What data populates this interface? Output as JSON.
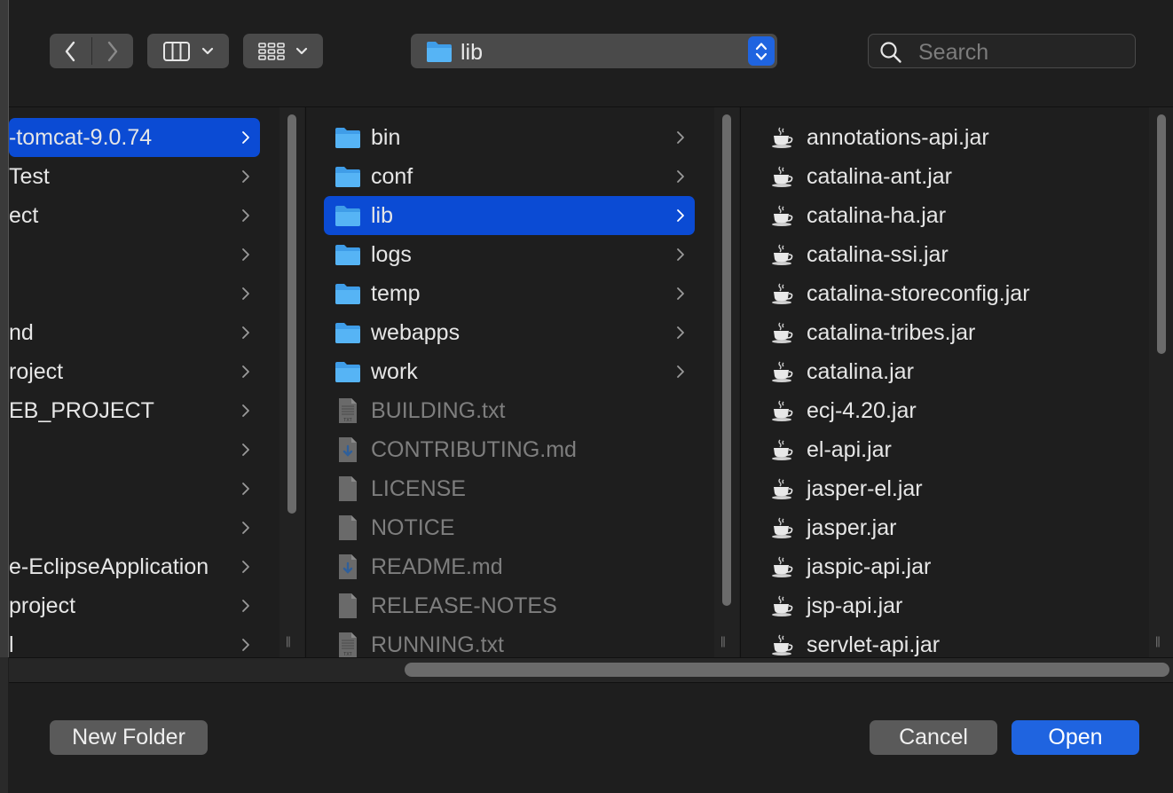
{
  "toolbar": {
    "path_label": "lib",
    "search_placeholder": "Search"
  },
  "column1": {
    "items": [
      {
        "label": "-tomcat-9.0.74",
        "selected": true
      },
      {
        "label": "Test"
      },
      {
        "label": "ect"
      },
      {
        "label": ""
      },
      {
        "label": ""
      },
      {
        "label": "nd"
      },
      {
        "label": "roject"
      },
      {
        "label": "EB_PROJECT"
      },
      {
        "label": ""
      },
      {
        "label": ""
      },
      {
        "label": ""
      },
      {
        "label": "e-EclipseApplication"
      },
      {
        "label": "project"
      },
      {
        "label": "l"
      }
    ]
  },
  "column2": {
    "items": [
      {
        "label": "bin",
        "icon": "folder-icon",
        "folder": true
      },
      {
        "label": "conf",
        "icon": "folder-icon",
        "folder": true
      },
      {
        "label": "lib",
        "icon": "folder-icon",
        "folder": true,
        "selected": true
      },
      {
        "label": "logs",
        "icon": "folder-icon",
        "folder": true
      },
      {
        "label": "temp",
        "icon": "folder-icon",
        "folder": true
      },
      {
        "label": "webapps",
        "icon": "folder-icon",
        "folder": true
      },
      {
        "label": "work",
        "icon": "folder-icon",
        "folder": true
      },
      {
        "label": "BUILDING.txt",
        "icon": "txt-file-icon",
        "dim": true
      },
      {
        "label": "CONTRIBUTING.md",
        "icon": "markdown-file-icon",
        "dim": true
      },
      {
        "label": "LICENSE",
        "icon": "document-icon",
        "dim": true
      },
      {
        "label": "NOTICE",
        "icon": "document-icon",
        "dim": true
      },
      {
        "label": "README.md",
        "icon": "markdown-file-icon",
        "dim": true
      },
      {
        "label": "RELEASE-NOTES",
        "icon": "document-icon",
        "dim": true
      },
      {
        "label": "RUNNING.txt",
        "icon": "txt-file-icon",
        "dim": true
      }
    ]
  },
  "column3": {
    "items": [
      {
        "label": "annotations-api.jar",
        "icon": "java-jar-icon"
      },
      {
        "label": "catalina-ant.jar",
        "icon": "java-jar-icon"
      },
      {
        "label": "catalina-ha.jar",
        "icon": "java-jar-icon"
      },
      {
        "label": "catalina-ssi.jar",
        "icon": "java-jar-icon"
      },
      {
        "label": "catalina-storeconfig.jar",
        "icon": "java-jar-icon"
      },
      {
        "label": "catalina-tribes.jar",
        "icon": "java-jar-icon"
      },
      {
        "label": "catalina.jar",
        "icon": "java-jar-icon"
      },
      {
        "label": "ecj-4.20.jar",
        "icon": "java-jar-icon"
      },
      {
        "label": "el-api.jar",
        "icon": "java-jar-icon"
      },
      {
        "label": "jasper-el.jar",
        "icon": "java-jar-icon"
      },
      {
        "label": "jasper.jar",
        "icon": "java-jar-icon"
      },
      {
        "label": "jaspic-api.jar",
        "icon": "java-jar-icon"
      },
      {
        "label": "jsp-api.jar",
        "icon": "java-jar-icon"
      },
      {
        "label": "servlet-api.jar",
        "icon": "java-jar-icon"
      }
    ]
  },
  "footer": {
    "new_folder_label": "New Folder",
    "cancel_label": "Cancel",
    "open_label": "Open"
  },
  "colors": {
    "selection": "#0b4bd4",
    "accent": "#1f64e0",
    "folder": "#46a8f0"
  }
}
